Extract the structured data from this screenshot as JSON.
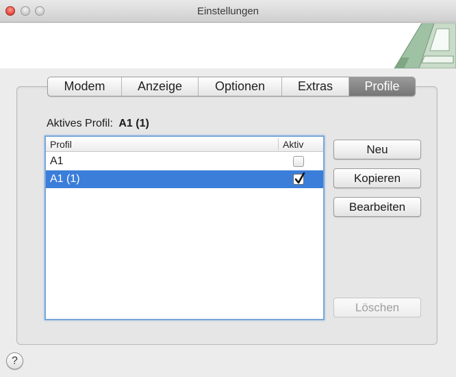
{
  "window": {
    "title": "Einstellungen"
  },
  "tabs": [
    {
      "label": "Modem",
      "active": false
    },
    {
      "label": "Anzeige",
      "active": false
    },
    {
      "label": "Optionen",
      "active": false
    },
    {
      "label": "Extras",
      "active": false
    },
    {
      "label": "Profile",
      "active": true
    }
  ],
  "active_profile": {
    "label": "Aktives Profil:",
    "value": "A1 (1)"
  },
  "profile_table": {
    "columns": [
      "Profil",
      "Aktiv"
    ],
    "rows": [
      {
        "name": "A1",
        "active": false,
        "selected": false
      },
      {
        "name": "A1 (1)",
        "active": true,
        "selected": true
      }
    ]
  },
  "buttons": {
    "new": "Neu",
    "copy": "Kopieren",
    "edit": "Bearbeiten",
    "delete": "Löschen"
  },
  "help": {
    "label": "?"
  },
  "colors": {
    "selection": "#3b7ed9",
    "focus_ring": "#7aa6d8",
    "close_button": "#e0443a"
  },
  "icons": {
    "logo": "app-logo-letter-a",
    "help": "help-icon",
    "checkbox": "checkmark-icon"
  }
}
